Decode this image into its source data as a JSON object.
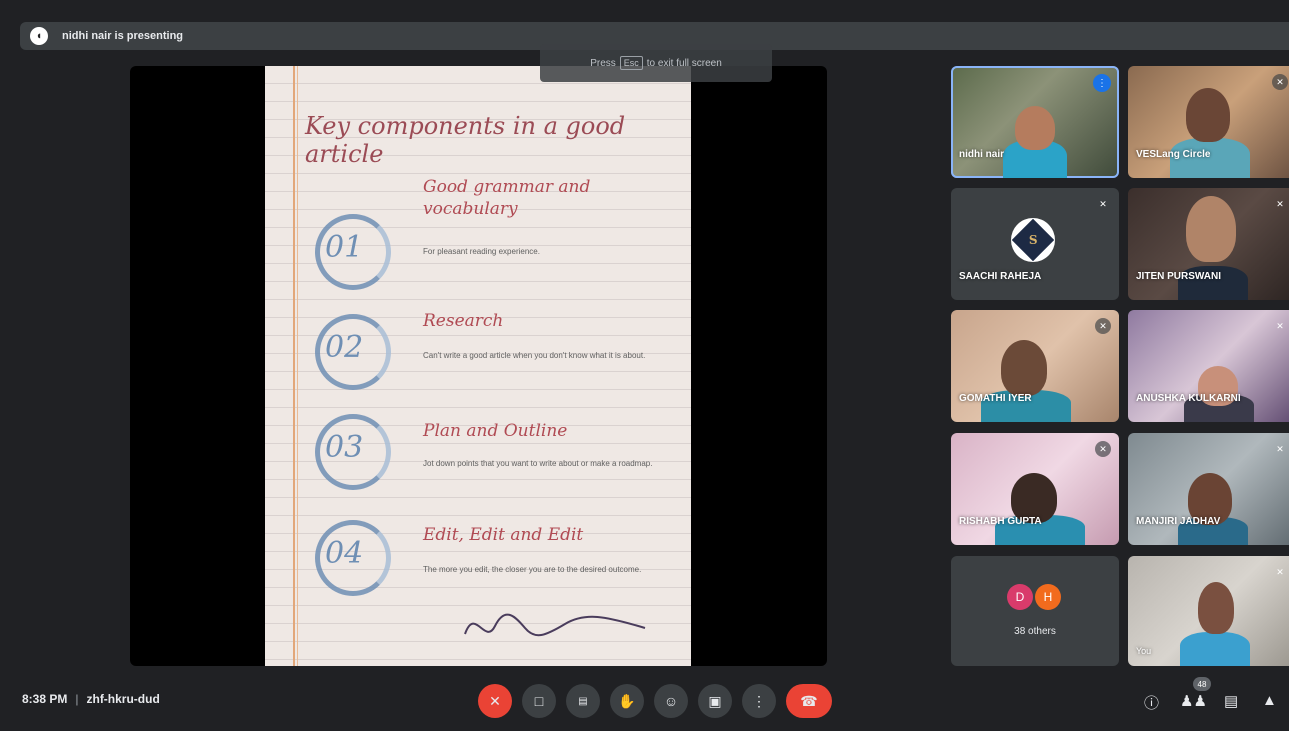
{
  "banner": {
    "presenter_text": "nidhi nair is presenting",
    "presenter_icon": "presenter-avatar-icon"
  },
  "fullscreen_hint": {
    "press": "Press",
    "key": "Esc",
    "rest": "to exit full screen"
  },
  "slide": {
    "title": "Key components in a good article",
    "items": [
      {
        "number": "01",
        "title": "Good grammar and vocabulary",
        "desc": "For pleasant reading experience."
      },
      {
        "number": "02",
        "title": "Research",
        "desc": "Can't write a good article when you don't know what it is about."
      },
      {
        "number": "03",
        "title": "Plan and Outline",
        "desc": "Jot down points that you want to write about or make a roadmap."
      },
      {
        "number": "04",
        "title": "Edit, Edit and Edit",
        "desc": "The more you edit, the closer you are to the desired outcome."
      }
    ]
  },
  "participants": [
    {
      "name": "nidhi nair",
      "status": "speaking"
    },
    {
      "name": "VESLang Circle",
      "status": "muted"
    },
    {
      "name": "SAACHI RAHEJA",
      "status": "muted"
    },
    {
      "name": "JITEN PURSWANI",
      "status": "muted"
    },
    {
      "name": "GOMATHI IYER",
      "status": "muted"
    },
    {
      "name": "ANUSHKA KULKARNI",
      "status": "muted"
    },
    {
      "name": "RISHABH GUPTA",
      "status": "muted"
    },
    {
      "name": "MANJIRI JADHAV",
      "status": "muted"
    },
    {
      "name": "You",
      "status": "muted"
    }
  ],
  "others": {
    "avatars": [
      "D",
      "H"
    ],
    "label": "38 others",
    "colors": [
      "#d93b6b",
      "#f26b1d"
    ]
  },
  "bottom": {
    "time": "8:38 PM",
    "separator": "|",
    "meeting_code": "zhf-hkru-dud",
    "people_count": "48"
  },
  "colors": {
    "end_call": "#ea4335",
    "accent": "#8ab4f8",
    "speaking": "#1a73e8"
  }
}
